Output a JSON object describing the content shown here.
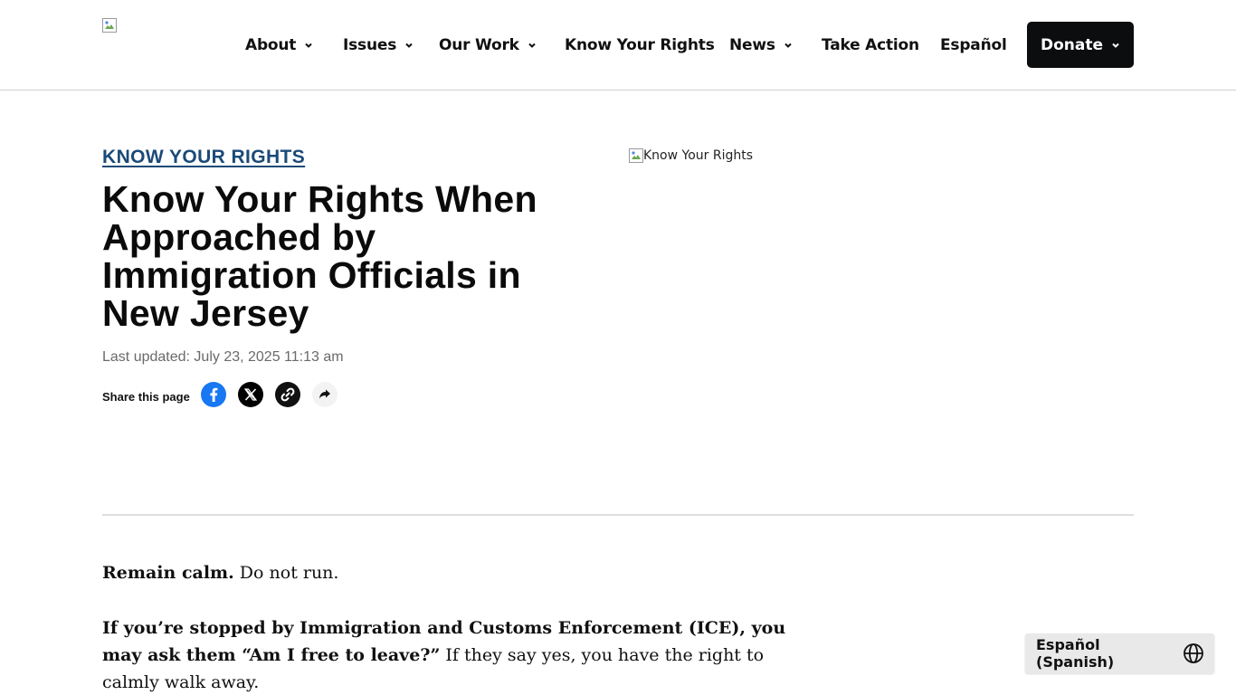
{
  "header": {
    "logo_alt": "",
    "nav": [
      {
        "label": "About",
        "has_menu": true
      },
      {
        "label": "Issues",
        "has_menu": true
      },
      {
        "label": "Our Work",
        "has_menu": true
      },
      {
        "label": "Know Your Rights",
        "has_menu": false
      },
      {
        "label": "News",
        "has_menu": true
      },
      {
        "label": "Take Action",
        "has_menu": false
      },
      {
        "label": "Español",
        "has_menu": false
      }
    ],
    "donate_label": "Donate"
  },
  "hero": {
    "kicker": "KNOW YOUR RIGHTS",
    "title": "Know Your Rights When Approached by Immigration Officials in New Jersey",
    "updated": "Last updated: July 23, 2025 11:13 am",
    "share_label": "Share this page",
    "image_alt": "Know Your Rights"
  },
  "body": {
    "p1_strong": "Remain calm.",
    "p1_text": " Do not run.",
    "p2_strong": "If you’re stopped by Immigration and Customs Enforcement (ICE), you may ask them “Am I free to leave?”",
    "p2_text": " If they say yes, you have the right to calmly walk away."
  },
  "language_toggle": {
    "label": "Español (Spanish)"
  },
  "colors": {
    "kicker": "#1b4a78",
    "donate_bg": "#0b0d0f",
    "facebook": "#1877f2",
    "toggle_bg": "#e9e9e9"
  },
  "icons": [
    "broken-image-icon",
    "chevron-down-icon",
    "facebook-icon",
    "x-icon",
    "link-icon",
    "share-icon",
    "globe-icon"
  ]
}
